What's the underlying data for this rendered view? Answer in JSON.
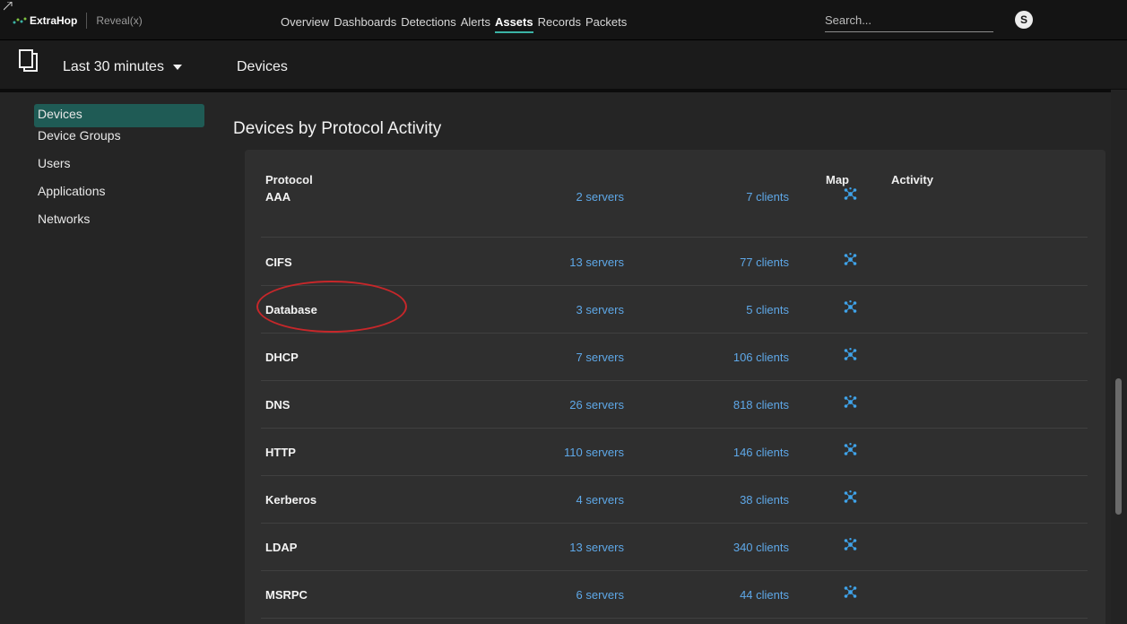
{
  "brand": {
    "name": "ExtraHop",
    "product": "Reveal(x)"
  },
  "nav": [
    {
      "label": "Overview",
      "active": false
    },
    {
      "label": "Dashboards",
      "active": false
    },
    {
      "label": "Detections",
      "active": false
    },
    {
      "label": "Alerts",
      "active": false
    },
    {
      "label": "Assets",
      "active": true
    },
    {
      "label": "Records",
      "active": false
    },
    {
      "label": "Packets",
      "active": false
    }
  ],
  "search": {
    "placeholder": "Search..."
  },
  "user": {
    "initial": "S"
  },
  "subheader": {
    "time_range": "Last 30 minutes",
    "breadcrumb": "Devices"
  },
  "sidebar": {
    "items": [
      {
        "label": "Devices",
        "active": true
      },
      {
        "label": "Device Groups",
        "active": false
      },
      {
        "label": "Users",
        "active": false
      },
      {
        "label": "Applications",
        "active": false
      },
      {
        "label": "Networks",
        "active": false
      }
    ]
  },
  "main": {
    "title": "Devices by Protocol Activity",
    "columns": {
      "protocol": "Protocol",
      "map": "Map",
      "activity": "Activity"
    },
    "rows": [
      {
        "protocol": "AAA",
        "servers": "2 servers",
        "clients": "7 clients"
      },
      {
        "protocol": "CIFS",
        "servers": "13 servers",
        "clients": "77 clients"
      },
      {
        "protocol": "Database",
        "servers": "3 servers",
        "clients": "5 clients"
      },
      {
        "protocol": "DHCP",
        "servers": "7 servers",
        "clients": "106 clients"
      },
      {
        "protocol": "DNS",
        "servers": "26 servers",
        "clients": "818 clients"
      },
      {
        "protocol": "HTTP",
        "servers": "110 servers",
        "clients": "146 clients"
      },
      {
        "protocol": "Kerberos",
        "servers": "4 servers",
        "clients": "38 clients"
      },
      {
        "protocol": "LDAP",
        "servers": "13 servers",
        "clients": "340 clients"
      },
      {
        "protocol": "MSRPC",
        "servers": "6 servers",
        "clients": "44 clients"
      }
    ]
  },
  "colors": {
    "accent": "#3bb3a5",
    "link": "#5ea8e8",
    "highlight": "#c7272a",
    "sidebar_active": "#1f5b55"
  },
  "icons": {
    "map": "network-map-icon",
    "devices": "devices-icon",
    "logo": "extrahop-logo-icon"
  }
}
